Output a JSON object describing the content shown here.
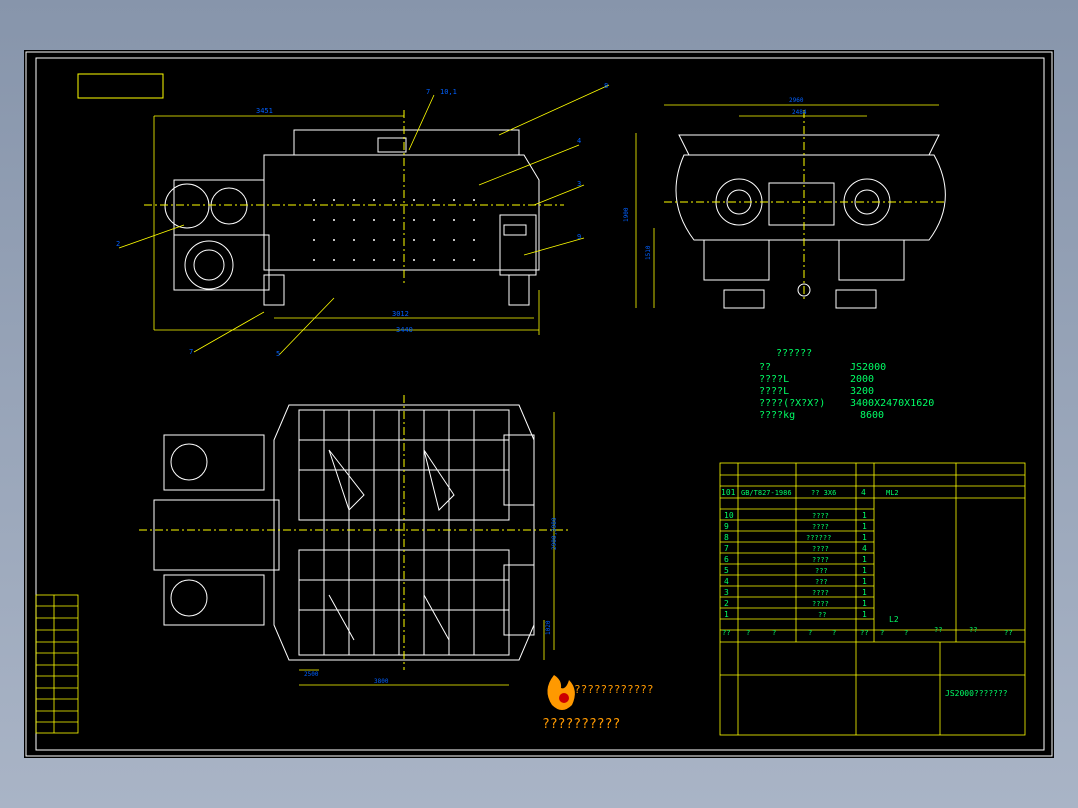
{
  "drawing": {
    "background": "#000000",
    "line_color": "#ffffff",
    "dim_color": "#ffff00",
    "text_color": "#00ff66",
    "label_color": "#0060ff",
    "logo_color": "#ff9900"
  },
  "front_view": {
    "callouts": [
      "7",
      "10,1",
      "8",
      "4",
      "3",
      "2",
      "9",
      "7",
      "5"
    ],
    "dims": [
      "3451",
      "3012",
      "3440"
    ]
  },
  "side_view": {
    "dims": [
      "2960",
      "2484",
      "1900",
      "1510"
    ]
  },
  "plan_view": {
    "dims": [
      "2500",
      "3800",
      "2900,3980",
      "1020"
    ]
  },
  "specs": {
    "title": "??????",
    "rows": [
      {
        "k": "??",
        "v": "JS2000"
      },
      {
        "k": "????L",
        "v": "2000"
      },
      {
        "k": "????L",
        "v": "3200"
      },
      {
        "k": "????(?X?X?)",
        "v": "3400X2470X1620"
      },
      {
        "k": "????kg",
        "v": "8600"
      }
    ]
  },
  "bom": {
    "rows": [
      {
        "no": "101",
        "code": "GB/T827-1986",
        "name": "?? 3X6",
        "qty": "4",
        "mat": "ML2"
      },
      {
        "no": "10",
        "code": "",
        "name": "????",
        "qty": "1",
        "mat": ""
      },
      {
        "no": "9",
        "code": "",
        "name": "????",
        "qty": "1",
        "mat": ""
      },
      {
        "no": "8",
        "code": "",
        "name": "??????",
        "qty": "1",
        "mat": ""
      },
      {
        "no": "7",
        "code": "",
        "name": "????",
        "qty": "4",
        "mat": ""
      },
      {
        "no": "6",
        "code": "",
        "name": "????",
        "qty": "1",
        "mat": ""
      },
      {
        "no": "5",
        "code": "",
        "name": "???",
        "qty": "1",
        "mat": ""
      },
      {
        "no": "4",
        "code": "",
        "name": "???",
        "qty": "1",
        "mat": ""
      },
      {
        "no": "3",
        "code": "",
        "name": "????",
        "qty": "1",
        "mat": ""
      },
      {
        "no": "2",
        "code": "",
        "name": "????",
        "qty": "1",
        "mat": ""
      },
      {
        "no": "1",
        "code": "",
        "name": "??",
        "qty": "1",
        "mat": "L2"
      }
    ],
    "header": [
      "??",
      "?",
      "?",
      "?",
      "?",
      "??",
      "?",
      "?",
      "??",
      "??",
      "??"
    ],
    "drawing_name": "JS2000???????"
  },
  "logo": {
    "line1": "????????????",
    "line2": "??????????"
  }
}
